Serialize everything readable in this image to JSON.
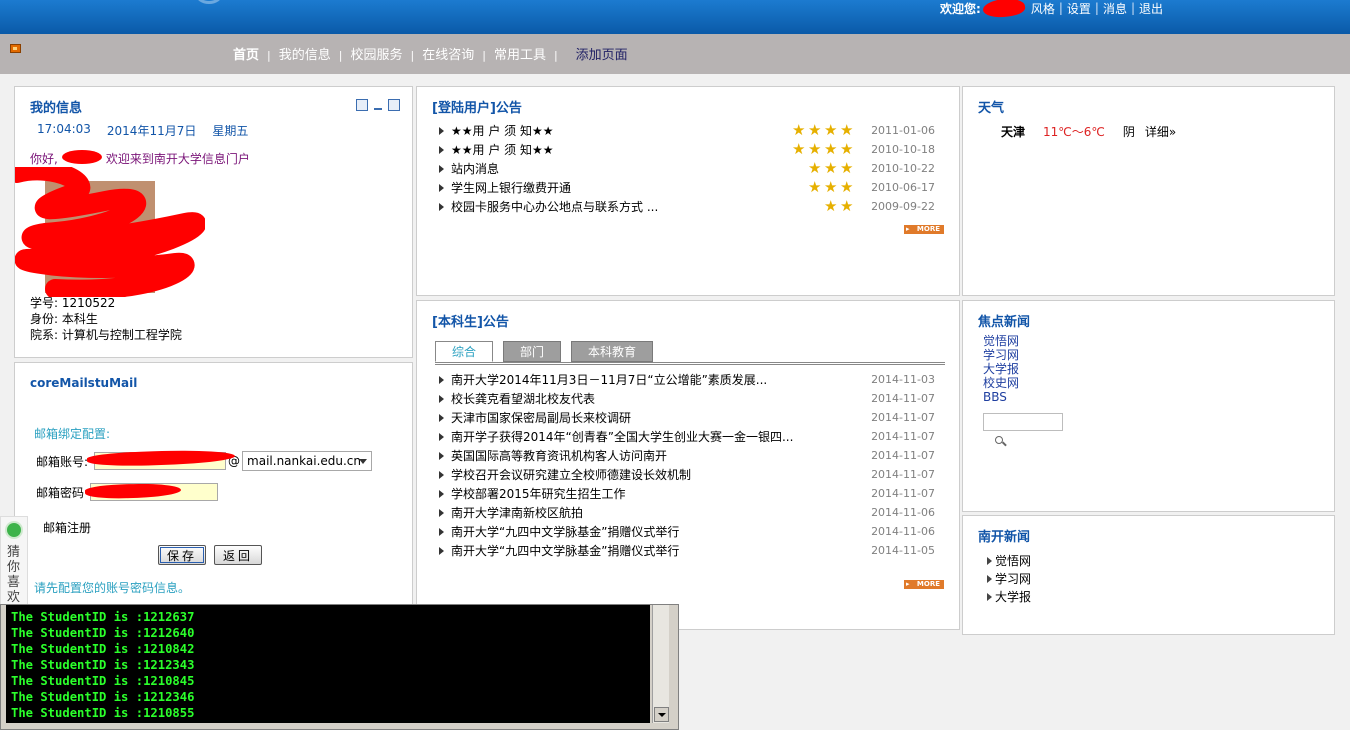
{
  "header": {
    "welcome_label": "欢迎您:",
    "links": [
      "风格",
      "设置",
      "消息",
      "退出"
    ]
  },
  "nav": {
    "items": [
      "首页",
      "我的信息",
      "校园服务",
      "在线咨询",
      "常用工具"
    ],
    "add_page": "添加页面"
  },
  "my_info": {
    "title": "我的信息",
    "time": "17:04:03",
    "date": "2014年11月7日",
    "weekday": "星期五",
    "hello_prefix": "你好,",
    "hello_suffix": "欢迎来到南开大学信息门户",
    "student_id": "学号: 1210522",
    "identity": "身份: 本科生",
    "department": "院系: 计算机与控制工程学院"
  },
  "mail": {
    "title": "coreMailstuMail",
    "config_label": "邮箱绑定配置:",
    "account_label": "邮箱账号:",
    "at": "@",
    "domain": "mail.nankai.edu.cn",
    "password_label": "邮箱密码",
    "register": "邮箱注册",
    "save": "保存",
    "back": "返回",
    "hint": "请先配置您的账号密码信息。"
  },
  "side_widget": {
    "text": "猜你喜欢"
  },
  "login_notice": {
    "title": "[登陆用户]公告",
    "more": "MORE",
    "items": [
      {
        "text": "★★用 户 须 知★★",
        "stars": 4,
        "date": "2011-01-06"
      },
      {
        "text": "★★用 户 须 知★★",
        "stars": 4,
        "date": "2010-10-18"
      },
      {
        "text": "站内消息",
        "stars": 3,
        "date": "2010-10-22"
      },
      {
        "text": "学生网上银行缴费开通",
        "stars": 3,
        "date": "2010-06-17"
      },
      {
        "text": "校园卡服务中心办公地点与联系方式 ...",
        "stars": 2,
        "date": "2009-09-22"
      }
    ]
  },
  "undergrad_notice": {
    "title": "[本科生]公告",
    "tabs": [
      "综合",
      "部门",
      "本科教育"
    ],
    "more": "MORE",
    "items": [
      {
        "text": "南开大学2014年11月3日－11月7日“立公增能”素质发展...",
        "date": "2014-11-03"
      },
      {
        "text": "校长龚克看望湖北校友代表",
        "date": "2014-11-07"
      },
      {
        "text": "天津市国家保密局副局长来校调研",
        "date": "2014-11-07"
      },
      {
        "text": "南开学子获得2014年“创青春”全国大学生创业大赛一金一银四...",
        "date": "2014-11-07"
      },
      {
        "text": "英国国际高等教育资讯机构客人访问南开",
        "date": "2014-11-07"
      },
      {
        "text": "学校召开会议研究建立全校师德建设长效机制",
        "date": "2014-11-07"
      },
      {
        "text": "学校部署2015年研究生招生工作",
        "date": "2014-11-07"
      },
      {
        "text": "南开大学津南新校区航拍",
        "date": "2014-11-06"
      },
      {
        "text": "南开大学“九四中文学脉基金”捐赠仪式举行",
        "date": "2014-11-06"
      },
      {
        "text": "南开大学“九四中文学脉基金”捐赠仪式举行",
        "date": "2014-11-05"
      }
    ]
  },
  "weather": {
    "title": "天气",
    "city": "天津",
    "temp": "11℃～6℃",
    "condition": "阴",
    "detail": "详细»"
  },
  "focus_news": {
    "title": "焦点新闻",
    "links": [
      "觉悟网",
      "学习网",
      "大学报",
      "校史网",
      "BBS"
    ]
  },
  "nankai_news": {
    "title": "南开新闻",
    "links": [
      "觉悟网",
      "学习网",
      "大学报"
    ]
  },
  "console": {
    "lines": [
      "The StudentID is :1212637",
      "The StudentID is :1212640",
      "The StudentID is :1210842",
      "The StudentID is :1212343",
      "The StudentID is :1210845",
      "The StudentID is :1212346",
      "The StudentID is :1210855"
    ]
  },
  "colors": {
    "banner": "#0a5aa8",
    "navbar": "#b7b3b3",
    "title_blue": "#1255a8",
    "console_text": "#2bff2b",
    "redaction": "#ff0000"
  }
}
